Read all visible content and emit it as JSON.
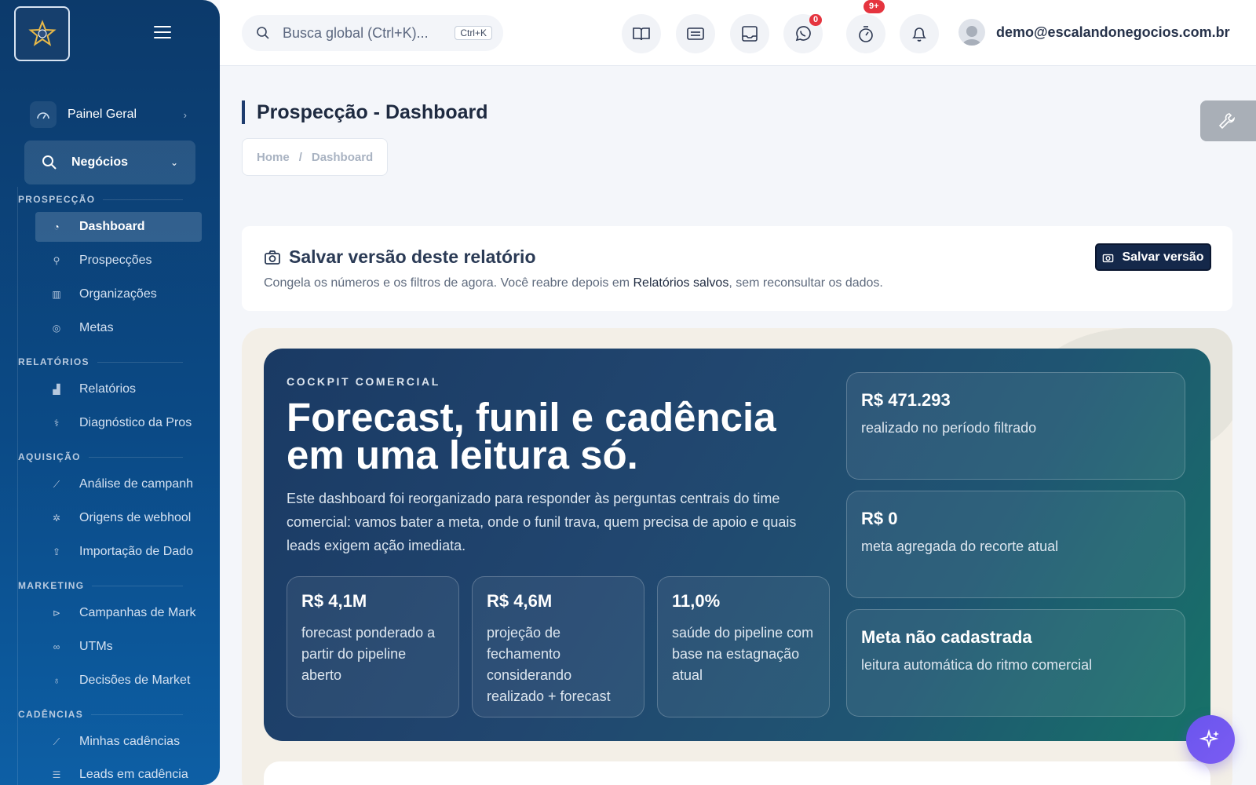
{
  "sidebar": {
    "top_item": "Painel Geral",
    "active_group": "Negócios",
    "sections": {
      "prospeccao": "PROSPECÇÃO",
      "relatorios": "RELATÓRIOS",
      "aquisicao": "AQUISIÇÃO",
      "marketing": "MARKETING",
      "cadencias": "CADÊNCIAS"
    },
    "items": {
      "dashboard": "Dashboard",
      "prospeccoes": "Prospecções",
      "organizacoes": "Organizações",
      "metas": "Metas",
      "relatorios": "Relatórios",
      "diagnostico": "Diagnóstico da Pros",
      "analise": "Análise de campanh",
      "origens": "Origens de webhool",
      "importacao": "Importação de Dado",
      "campanhas": "Campanhas de Mark",
      "utms": "UTMs",
      "decisoes": "Decisões de Market",
      "minhas_cadencias": "Minhas cadências",
      "leads_cadencia": "Leads em cadência"
    }
  },
  "topbar": {
    "search_placeholder": "Busca global (Ctrl+K)...",
    "search_shortcut": "Ctrl+K",
    "whatsapp_badge": "0",
    "timer_badge": "9+",
    "user_email": "demo@escalandonegocios.com.br"
  },
  "page": {
    "title": "Prospecção - Dashboard",
    "breadcrumb": [
      "Home",
      "/",
      "Dashboard"
    ]
  },
  "save_card": {
    "title": "Salvar versão deste relatório",
    "desc_before": "Congela os números e os filtros de agora. Você reabre depois em ",
    "desc_link": "Relatórios salvos",
    "desc_after": ", sem reconsultar os dados.",
    "button": "Salvar versão"
  },
  "hero": {
    "eyebrow": "COCKPIT COMERCIAL",
    "headline": "Forecast, funil e cadência em uma leitura só.",
    "lead": "Este dashboard foi reorganizado para responder às perguntas centrais do time comercial: vamos bater a meta, onde o funil trava, quem precisa de apoio e quais leads exigem ação imediata.",
    "kpis": [
      {
        "value": "R$ 4,1M",
        "label": "forecast ponderado a partir do pipeline aberto"
      },
      {
        "value": "R$ 4,6M",
        "label": "projeção de fechamento considerando realizado + forecast"
      },
      {
        "value": "11,0%",
        "label": "saúde do pipeline com base na estagnação atual"
      }
    ],
    "side": [
      {
        "value": "R$ 471.293",
        "label": "realizado no período filtrado"
      },
      {
        "value": "R$ 0",
        "label": "meta agregada do recorte atual"
      },
      {
        "value": "Meta não cadastrada",
        "label": "leitura automática do ritmo comercial"
      }
    ]
  },
  "colors": {
    "sidebar": "#0b4a86",
    "save_button": "#14284a",
    "badge": "#e5343f",
    "ai_button": "#6a55ee"
  }
}
